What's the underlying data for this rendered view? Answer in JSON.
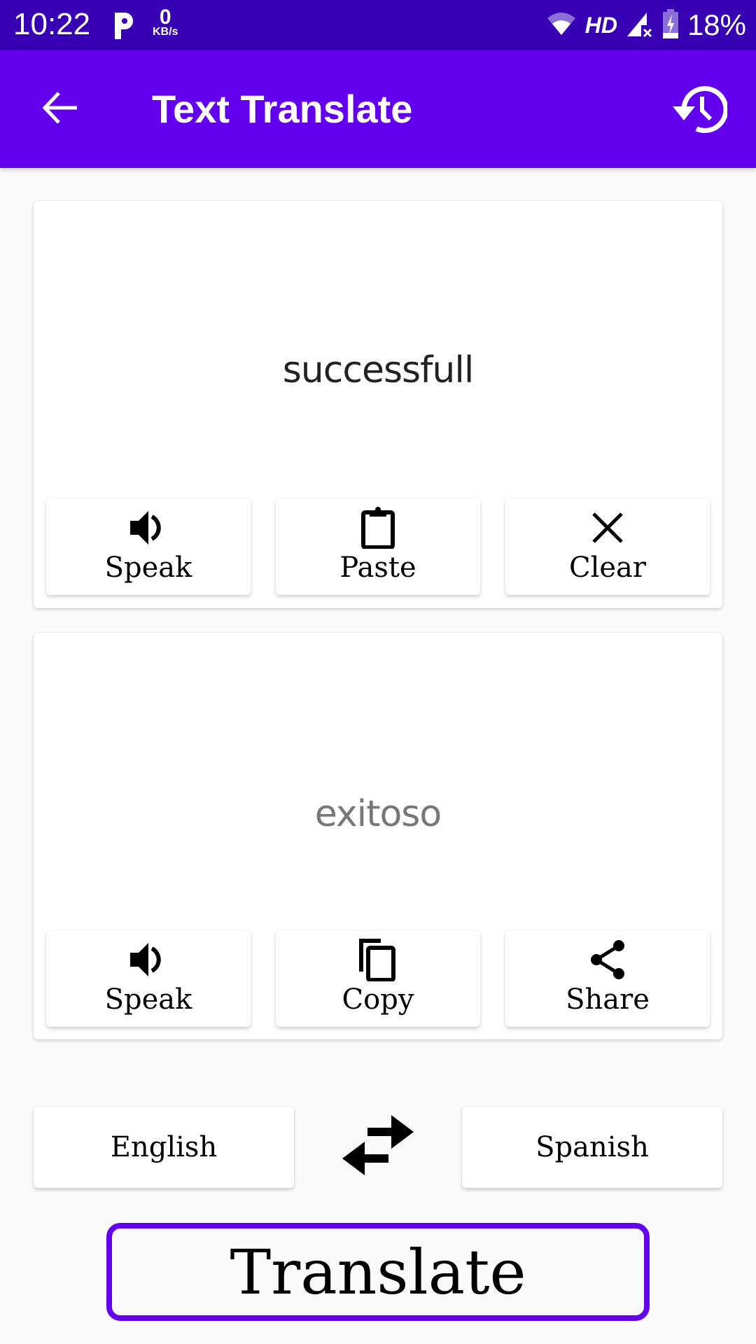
{
  "status_bar": {
    "time": "10:22",
    "net_speed_value": "0",
    "net_speed_unit": "KB/s",
    "network_label": "HD",
    "battery_percent": "18%",
    "icons": [
      "parking-app-icon",
      "wifi-icon",
      "signal-no-service-icon",
      "battery-charging-icon"
    ]
  },
  "app_bar": {
    "title": "Text Translate",
    "back_icon": "arrow-back-icon",
    "history_icon": "history-icon",
    "background_color": "#6200ee",
    "status_bar_color": "#3700b3"
  },
  "source_card": {
    "text": "successfull",
    "buttons": [
      {
        "label": "Speak",
        "icon": "volume-icon"
      },
      {
        "label": "Paste",
        "icon": "clipboard-icon"
      },
      {
        "label": "Clear",
        "icon": "close-icon"
      }
    ]
  },
  "result_card": {
    "text": "exitoso",
    "buttons": [
      {
        "label": "Speak",
        "icon": "volume-icon"
      },
      {
        "label": "Copy",
        "icon": "copy-icon"
      },
      {
        "label": "Share",
        "icon": "share-icon"
      }
    ]
  },
  "languages": {
    "source": "English",
    "target": "Spanish",
    "swap_icon": "swap-arrows-icon"
  },
  "translate_button": {
    "label": "Translate",
    "border_color": "#6200ee"
  }
}
